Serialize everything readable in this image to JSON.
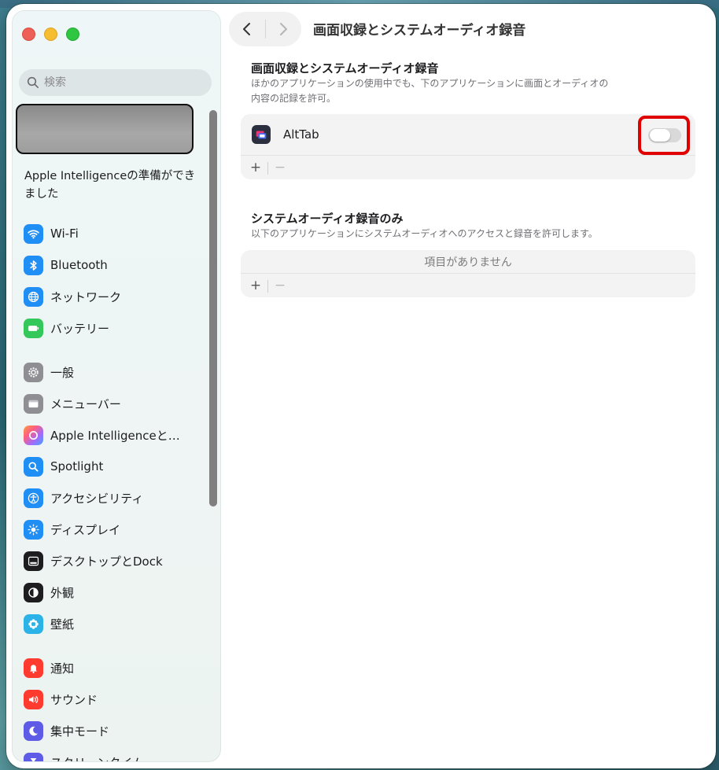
{
  "window": {
    "traffic_lights": [
      "close",
      "minimize",
      "zoom"
    ]
  },
  "sidebar": {
    "search_placeholder": "検索",
    "ai_notice": "Apple Intelligenceの準備ができました",
    "items": [
      {
        "label": "Wi-Fi",
        "icon": "wifi-icon",
        "color": "#1f8ef5"
      },
      {
        "label": "Bluetooth",
        "icon": "bluetooth-icon",
        "color": "#1f8ef5"
      },
      {
        "label": "ネットワーク",
        "icon": "globe-icon",
        "color": "#1f8ef5"
      },
      {
        "label": "バッテリー",
        "icon": "battery-icon",
        "color": "#34c759"
      },
      {
        "label": "一般",
        "icon": "gear-icon",
        "color": "#8e8e93"
      },
      {
        "label": "メニューバー",
        "icon": "menubar-icon",
        "color": "#8e8e93"
      },
      {
        "label": "Apple Intelligenceと…",
        "icon": "apple-intelligence-icon",
        "color": "#ff6f61"
      },
      {
        "label": "Spotlight",
        "icon": "magnifier-icon",
        "color": "#1f8ef5"
      },
      {
        "label": "アクセシビリティ",
        "icon": "accessibility-icon",
        "color": "#1f8ef5"
      },
      {
        "label": "ディスプレイ",
        "icon": "sun-icon",
        "color": "#1f8ef5"
      },
      {
        "label": "デスクトップとDock",
        "icon": "dock-icon",
        "color": "#1d1d1f"
      },
      {
        "label": "外観",
        "icon": "appearance-icon",
        "color": "#1d1d1f"
      },
      {
        "label": "壁紙",
        "icon": "wallpaper-icon",
        "color": "#2bb3e8"
      },
      {
        "label": "通知",
        "icon": "bell-icon",
        "color": "#ff3b30"
      },
      {
        "label": "サウンド",
        "icon": "speaker-icon",
        "color": "#ff3b30"
      },
      {
        "label": "集中モード",
        "icon": "moon-icon",
        "color": "#5e5ce6"
      },
      {
        "label": "スクリーンタイム",
        "icon": "hourglass-icon",
        "color": "#5e5ce6"
      }
    ]
  },
  "main": {
    "page_title": "画面収録とシステムオーディオ録音",
    "section1": {
      "title": "画面収録とシステムオーディオ録音",
      "desc_line1": "ほかのアプリケーションの使用中でも、下のアプリケーションに画面とオーディオの",
      "desc_line2": "内容の記録を許可。",
      "apps": [
        {
          "name": "AltTab",
          "enabled": false
        }
      ],
      "add_label": "+",
      "remove_label": "−"
    },
    "section2": {
      "title": "システムオーディオ録音のみ",
      "desc": "以下のアプリケーションにシステムオーディオへのアクセスと録音を許可します。",
      "empty_text": "項目がありません",
      "add_label": "+",
      "remove_label": "−"
    }
  }
}
